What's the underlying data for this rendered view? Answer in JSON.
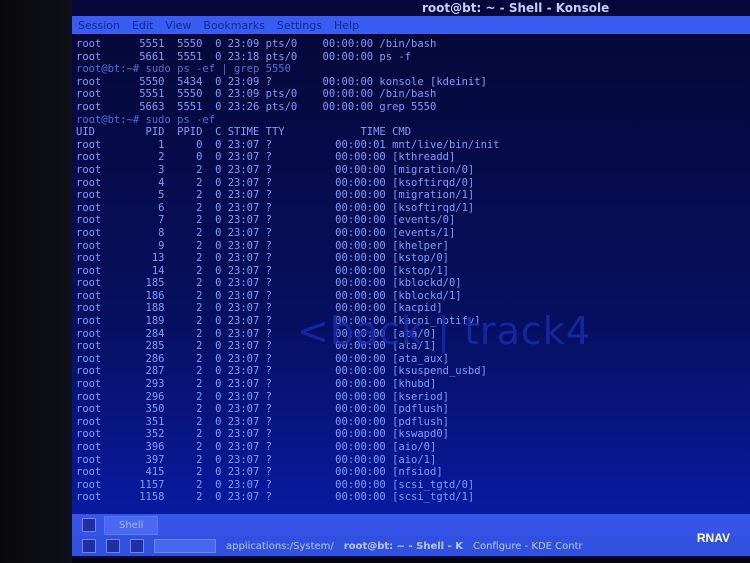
{
  "window": {
    "title": "root@bt: ~ - Shell - Konsole"
  },
  "menu": [
    "Session",
    "Edit",
    "View",
    "Bookmarks",
    "Settings",
    "Help"
  ],
  "terminal": {
    "pre_lines": [
      {
        "text": "root      5551  5550  0 23:09 pts/0    00:00:00 /bin/bash",
        "prompt": false
      },
      {
        "text": "root      5661  5551  0 23:18 pts/0    00:00:00 ps -f",
        "prompt": false
      },
      {
        "text": "root@bt:~# sudo ps -ef | grep 5550",
        "prompt": true
      },
      {
        "text": "root      5550  5434  0 23:09 ?        00:00:00 konsole [kdeinit]",
        "prompt": false
      },
      {
        "text": "root      5551  5550  0 23:09 pts/0    00:00:00 /bin/bash",
        "prompt": false
      },
      {
        "text": "root      5663  5551  0 23:26 pts/0    00:00:00 grep 5550",
        "prompt": false
      },
      {
        "text": "root@bt:~# sudo ps -ef",
        "prompt": true
      }
    ],
    "columns": [
      "UID",
      "PID",
      "PPID",
      "C",
      "STIME",
      "TTY",
      "TIME",
      "CMD"
    ],
    "processes": [
      [
        "root",
        "1",
        "0",
        "0",
        "23:07",
        "?",
        "00:00:01",
        "mnt/live/bin/init"
      ],
      [
        "root",
        "2",
        "0",
        "0",
        "23:07",
        "?",
        "00:00:00",
        "[kthreadd]"
      ],
      [
        "root",
        "3",
        "2",
        "0",
        "23:07",
        "?",
        "00:00:00",
        "[migration/0]"
      ],
      [
        "root",
        "4",
        "2",
        "0",
        "23:07",
        "?",
        "00:00:00",
        "[ksoftirqd/0]"
      ],
      [
        "root",
        "5",
        "2",
        "0",
        "23:07",
        "?",
        "00:00:00",
        "[migration/1]"
      ],
      [
        "root",
        "6",
        "2",
        "0",
        "23:07",
        "?",
        "00:00:00",
        "[ksoftirqd/1]"
      ],
      [
        "root",
        "7",
        "2",
        "0",
        "23:07",
        "?",
        "00:00:00",
        "[events/0]"
      ],
      [
        "root",
        "8",
        "2",
        "0",
        "23:07",
        "?",
        "00:00:00",
        "[events/1]"
      ],
      [
        "root",
        "9",
        "2",
        "0",
        "23:07",
        "?",
        "00:00:00",
        "[khelper]"
      ],
      [
        "root",
        "13",
        "2",
        "0",
        "23:07",
        "?",
        "00:00:00",
        "[kstop/0]"
      ],
      [
        "root",
        "14",
        "2",
        "0",
        "23:07",
        "?",
        "00:00:00",
        "[kstop/1]"
      ],
      [
        "root",
        "185",
        "2",
        "0",
        "23:07",
        "?",
        "00:00:00",
        "[kblockd/0]"
      ],
      [
        "root",
        "186",
        "2",
        "0",
        "23:07",
        "?",
        "00:00:00",
        "[kblockd/1]"
      ],
      [
        "root",
        "188",
        "2",
        "0",
        "23:07",
        "?",
        "00:00:00",
        "[kacpid]"
      ],
      [
        "root",
        "189",
        "2",
        "0",
        "23:07",
        "?",
        "00:00:00",
        "[kacpi_notify]"
      ],
      [
        "root",
        "284",
        "2",
        "0",
        "23:07",
        "?",
        "00:00:00",
        "[ata/0]"
      ],
      [
        "root",
        "285",
        "2",
        "0",
        "23:07",
        "?",
        "00:00:00",
        "[ata/1]"
      ],
      [
        "root",
        "286",
        "2",
        "0",
        "23:07",
        "?",
        "00:00:00",
        "[ata_aux]"
      ],
      [
        "root",
        "287",
        "2",
        "0",
        "23:07",
        "?",
        "00:00:00",
        "[ksuspend_usbd]"
      ],
      [
        "root",
        "293",
        "2",
        "0",
        "23:07",
        "?",
        "00:00:00",
        "[khubd]"
      ],
      [
        "root",
        "296",
        "2",
        "0",
        "23:07",
        "?",
        "00:00:00",
        "[kseriod]"
      ],
      [
        "root",
        "350",
        "2",
        "0",
        "23:07",
        "?",
        "00:00:00",
        "[pdflush]"
      ],
      [
        "root",
        "351",
        "2",
        "0",
        "23:07",
        "?",
        "00:00:00",
        "[pdflush]"
      ],
      [
        "root",
        "352",
        "2",
        "0",
        "23:07",
        "?",
        "00:00:00",
        "[kswapd0]"
      ],
      [
        "root",
        "396",
        "2",
        "0",
        "23:07",
        "?",
        "00:00:00",
        "[aio/0]"
      ],
      [
        "root",
        "397",
        "2",
        "0",
        "23:07",
        "?",
        "00:00:00",
        "[aio/1]"
      ],
      [
        "root",
        "415",
        "2",
        "0",
        "23:07",
        "?",
        "00:00:00",
        "[nfsiod]"
      ],
      [
        "root",
        "1157",
        "2",
        "0",
        "23:07",
        "?",
        "00:00:00",
        "[scsi_tgtd/0]"
      ],
      [
        "root",
        "1158",
        "2",
        "0",
        "23:07",
        "?",
        "00:00:00",
        "[scsi_tgtd/1]"
      ]
    ],
    "background_logo": "<back | track4"
  },
  "tabs": {
    "active": "Shell"
  },
  "taskbar": {
    "location": "applications:/System/",
    "window1": "root@bt: ~ - Shell - K",
    "window2": "Configure - KDE Contr"
  },
  "watermark": "RNAV"
}
